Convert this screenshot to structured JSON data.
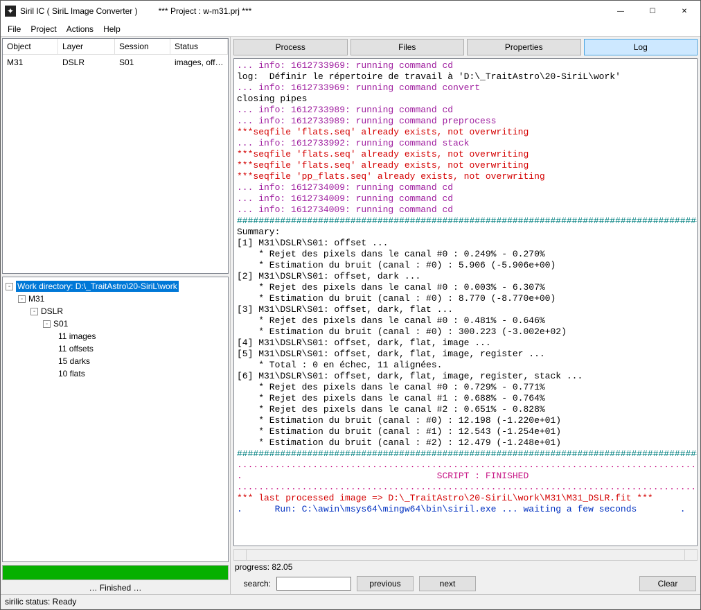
{
  "window": {
    "app_title": "Siril IC  ( SiriL Image Converter )",
    "project_label": "*** Project : w-m31.prj ***",
    "min": "—",
    "max": "☐",
    "close": "✕"
  },
  "menu": {
    "file": "File",
    "project": "Project",
    "actions": "Actions",
    "help": "Help"
  },
  "table": {
    "headers": {
      "object": "Object",
      "layer": "Layer",
      "session": "Session",
      "status": "Status"
    },
    "row": {
      "object": "M31",
      "layer": "DSLR",
      "session": "S01",
      "status": "images, off…"
    }
  },
  "tree": {
    "root": "Work directory: D:\\_TraitAstro\\20-SiriL\\work",
    "n1": "M31",
    "n2": "DSLR",
    "n3": "S01",
    "leaf1": "11 images",
    "leaf2": "11 offsets",
    "leaf3": "15 darks",
    "leaf4": "10 flats"
  },
  "progress_fill_pct": 100,
  "left_status": "… Finished …",
  "tabs": {
    "process": "Process",
    "files": "Files",
    "properties": "Properties",
    "log": "Log"
  },
  "log_lines": [
    {
      "cls": "c-purple",
      "t": "... info: 1612733969: running command cd"
    },
    {
      "cls": "c-black",
      "t": "log:  Définir le répertoire de travail à 'D:\\_TraitAstro\\20-SiriL\\work'"
    },
    {
      "cls": "c-purple",
      "t": "... info: 1612733969: running command convert"
    },
    {
      "cls": "c-black",
      "t": "closing pipes"
    },
    {
      "cls": "c-purple",
      "t": "... info: 1612733989: running command cd"
    },
    {
      "cls": "c-purple",
      "t": "... info: 1612733989: running command preprocess"
    },
    {
      "cls": "c-red",
      "t": "***seqfile 'flats.seq' already exists, not overwriting"
    },
    {
      "cls": "c-purple",
      "t": "... info: 1612733992: running command stack"
    },
    {
      "cls": "c-red",
      "t": "***seqfile 'flats.seq' already exists, not overwriting"
    },
    {
      "cls": "c-red",
      "t": "***seqfile 'flats.seq' already exists, not overwriting"
    },
    {
      "cls": "c-red",
      "t": "***seqfile 'pp_flats.seq' already exists, not overwriting"
    },
    {
      "cls": "c-purple",
      "t": "... info: 1612734009: running command cd"
    },
    {
      "cls": "c-purple",
      "t": "... info: 1612734009: running command cd"
    },
    {
      "cls": "c-purple",
      "t": "... info: 1612734009: running command cd"
    },
    {
      "cls": "c-teal",
      "t": "###########################################################################################"
    },
    {
      "cls": "c-black",
      "t": "Summary:"
    },
    {
      "cls": "c-black",
      "t": "[1] M31\\DSLR\\S01: offset ..."
    },
    {
      "cls": "c-black",
      "t": "    * Rejet des pixels dans le canal #0 : 0.249% - 0.270%"
    },
    {
      "cls": "c-black",
      "t": "    * Estimation du bruit (canal : #0) : 5.906 (-5.906e+00)"
    },
    {
      "cls": "c-black",
      "t": "[2] M31\\DSLR\\S01: offset, dark ..."
    },
    {
      "cls": "c-black",
      "t": "    * Rejet des pixels dans le canal #0 : 0.003% - 6.307%"
    },
    {
      "cls": "c-black",
      "t": "    * Estimation du bruit (canal : #0) : 8.770 (-8.770e+00)"
    },
    {
      "cls": "c-black",
      "t": "[3] M31\\DSLR\\S01: offset, dark, flat ..."
    },
    {
      "cls": "c-black",
      "t": "    * Rejet des pixels dans le canal #0 : 0.481% - 0.646%"
    },
    {
      "cls": "c-black",
      "t": "    * Estimation du bruit (canal : #0) : 300.223 (-3.002e+02)"
    },
    {
      "cls": "c-black",
      "t": "[4] M31\\DSLR\\S01: offset, dark, flat, image ..."
    },
    {
      "cls": "c-black",
      "t": "[5] M31\\DSLR\\S01: offset, dark, flat, image, register ..."
    },
    {
      "cls": "c-black",
      "t": "    * Total : 0 en échec, 11 alignées."
    },
    {
      "cls": "c-black",
      "t": "[6] M31\\DSLR\\S01: offset, dark, flat, image, register, stack ..."
    },
    {
      "cls": "c-black",
      "t": "    * Rejet des pixels dans le canal #0 : 0.729% - 0.771%"
    },
    {
      "cls": "c-black",
      "t": "    * Rejet des pixels dans le canal #1 : 0.688% - 0.764%"
    },
    {
      "cls": "c-black",
      "t": "    * Rejet des pixels dans le canal #2 : 0.651% - 0.828%"
    },
    {
      "cls": "c-black",
      "t": "    * Estimation du bruit (canal : #0) : 12.198 (-1.220e+01)"
    },
    {
      "cls": "c-black",
      "t": "    * Estimation du bruit (canal : #1) : 12.543 (-1.254e+01)"
    },
    {
      "cls": "c-black",
      "t": "    * Estimation du bruit (canal : #2) : 12.479 (-1.248e+01)"
    },
    {
      "cls": "c-teal",
      "t": "###########################################################################################"
    },
    {
      "cls": "c-pink",
      "t": "..........................................................................................."
    },
    {
      "cls": "c-pink",
      "t": ".                                    SCRIPT : FINISHED                                    ."
    },
    {
      "cls": "c-pink",
      "t": "..........................................................................................."
    },
    {
      "cls": "c-black",
      "t": ""
    },
    {
      "cls": "c-red",
      "t": "*** last processed image => D:\\_TraitAstro\\20-SiriL\\work\\M31\\M31_DSLR.fit ***"
    },
    {
      "cls": "c-blue",
      "t": ".      Run: C:\\awin\\msys64\\mingw64\\bin\\siril.exe ... waiting a few seconds        ."
    }
  ],
  "progress_text": "progress: 82.05",
  "search": {
    "label": "search:",
    "prev": "previous",
    "next": "next",
    "clear": "Clear",
    "value": ""
  },
  "status_bar": "sirilic status: Ready"
}
